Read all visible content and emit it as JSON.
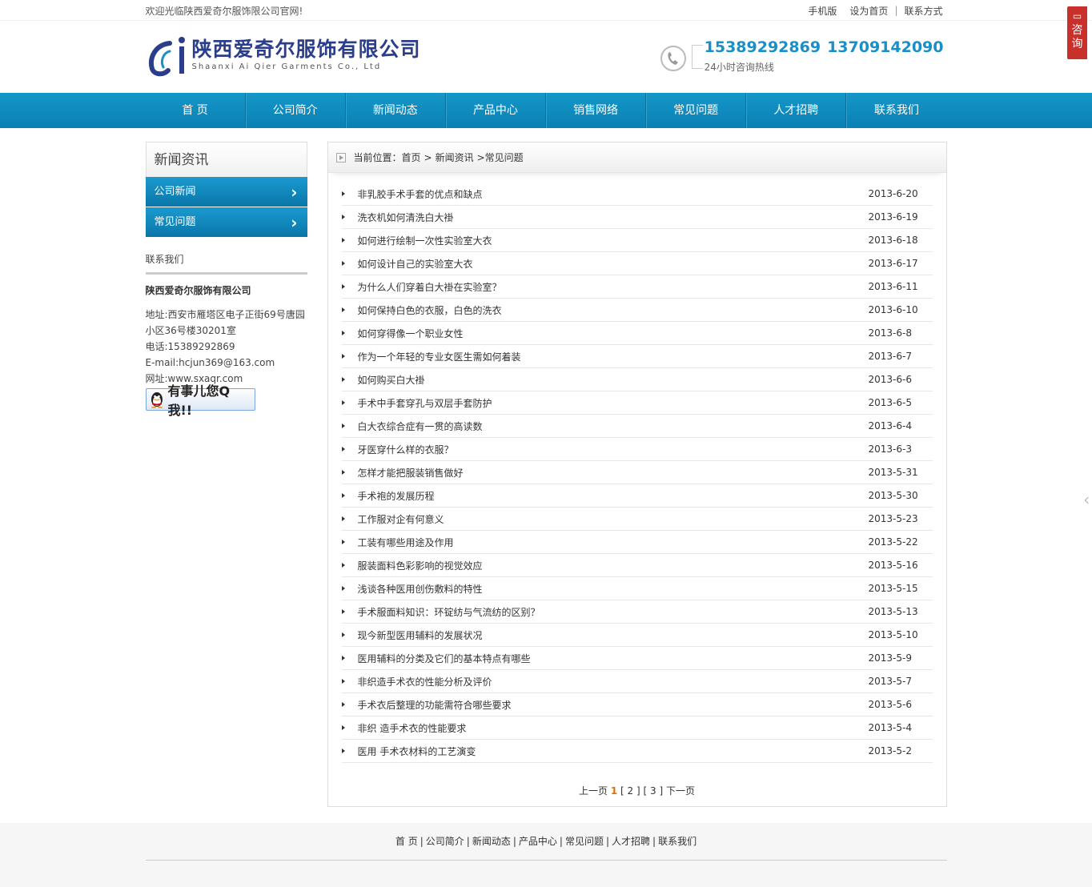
{
  "topbar": {
    "welcome": "欢迎光临陕西爱奇尔服饰限公司官网!",
    "links": [
      "手机版",
      "设为首页",
      "联系方式"
    ]
  },
  "header": {
    "logo_cn": "陕西爱奇尔服饰有限公司",
    "logo_en": "Shaanxi Ai Qier Garments Co., Ltd",
    "phone1": "15389292869",
    "phone2": "13709142090",
    "hotline_label": "24小时咨询热线"
  },
  "nav": [
    "首 页",
    "公司简介",
    "新闻动态",
    "产品中心",
    "销售网络",
    "常见问题",
    "人才招聘",
    "联系我们"
  ],
  "sidebar": {
    "title": "新闻资讯",
    "menu": [
      "公司新闻",
      "常见问题"
    ],
    "contact_title": "联系我们",
    "company": "陕西爱奇尔服饰有限公司",
    "address_line1": "地址:西安市雁塔区电子正街69号唐园",
    "address_line2": "小区36号楼30201室",
    "phone": "电话:15389292869",
    "email": "E-mail:hcjun369@163.com",
    "website": "网址:www.sxaqr.com",
    "qq_label": "有事儿您Q我!!"
  },
  "breadcrumb": {
    "label": "当前位置：",
    "items": [
      "首页",
      "新闻资讯",
      "常见问题"
    ]
  },
  "articles": [
    {
      "title": "非乳胶手术手套的优点和缺点",
      "date": "2013-6-20"
    },
    {
      "title": "洗衣机如何清洗白大褂",
      "date": "2013-6-19"
    },
    {
      "title": "如何进行绘制一次性实验室大衣",
      "date": "2013-6-18"
    },
    {
      "title": "如何设计自己的实验室大衣",
      "date": "2013-6-17"
    },
    {
      "title": "为什么人们穿着白大褂在实验室？",
      "date": "2013-6-11"
    },
    {
      "title": "如何保持白色的衣服，白色的洗衣",
      "date": "2013-6-10"
    },
    {
      "title": "如何穿得像一个职业女性",
      "date": "2013-6-8"
    },
    {
      "title": "作为一个年轻的专业女医生需如何着装",
      "date": "2013-6-7"
    },
    {
      "title": "如何购买白大褂",
      "date": "2013-6-6"
    },
    {
      "title": "手术中手套穿孔与双层手套防护",
      "date": "2013-6-5"
    },
    {
      "title": "白大衣综合症有一贯的高读数",
      "date": "2013-6-4"
    },
    {
      "title": "牙医穿什么样的衣服？",
      "date": "2013-6-3"
    },
    {
      "title": "怎样才能把服装销售做好",
      "date": "2013-5-31"
    },
    {
      "title": "手术袍的发展历程",
      "date": "2013-5-30"
    },
    {
      "title": "工作服对企有何意义",
      "date": "2013-5-23"
    },
    {
      "title": "工装有哪些用途及作用",
      "date": "2013-5-22"
    },
    {
      "title": "服装面料色彩影响的视觉效应",
      "date": "2013-5-16"
    },
    {
      "title": "浅谈各种医用创伤敷料的特性",
      "date": "2013-5-15"
    },
    {
      "title": "手术服面料知识：环锭纺与气流纺的区别？",
      "date": "2013-5-13"
    },
    {
      "title": "现今新型医用辅料的发展状况",
      "date": "2013-5-10"
    },
    {
      "title": "医用辅料的分类及它们的基本特点有哪些",
      "date": "2013-5-9"
    },
    {
      "title": "非织造手术衣的性能分析及评价",
      "date": "2013-5-7"
    },
    {
      "title": "手术衣后整理的功能需符合哪些要求",
      "date": "2013-5-6"
    },
    {
      "title": "非织 造手术衣的性能要求",
      "date": "2013-5-4"
    },
    {
      "title": "医用 手术衣材料的工艺演变",
      "date": "2013-5-2"
    }
  ],
  "pager": {
    "prev": "上一页",
    "current": "1",
    "pages": [
      "[ 2 ]",
      "[ 3 ]"
    ],
    "next": "下一页"
  },
  "footer": {
    "links": [
      "首 页",
      "公司简介",
      "新闻动态",
      "产品中心",
      "常见问题",
      "人才招聘",
      "联系我们"
    ]
  },
  "consult": {
    "label": "咨询"
  },
  "colors": {
    "primary": "#0e8cc0",
    "phone": "#1a8fc7",
    "consult": "#c7302b",
    "logo": "#2b3e8c"
  }
}
